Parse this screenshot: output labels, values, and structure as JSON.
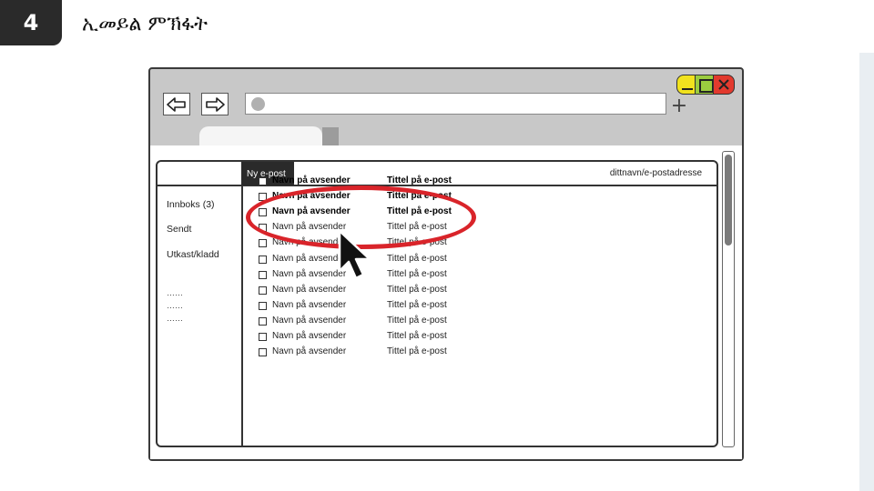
{
  "step": {
    "number": "4",
    "title": "ኢመይል ምኽፋት"
  },
  "browser": {
    "back_icon": "arrow-left-icon",
    "forward_icon": "arrow-right-icon",
    "new_tab_symbol": "+",
    "window_controls": [
      "minimize",
      "maximize",
      "close"
    ],
    "colors": {
      "minimize": "#f1e21e",
      "maximize": "#9bcc3f",
      "close": "#e23a2e"
    }
  },
  "mail": {
    "new_mail_label": "Ny e-post",
    "user_address": "dittnavn/e-postadresse",
    "folders": [
      "Innboks (3)",
      "Sendt",
      "Utkast/kladd"
    ],
    "placeholders": [
      "……",
      "……",
      "……"
    ],
    "rows": [
      {
        "sender": "Navn på avsender",
        "subject": "Tittel på e-post",
        "unread": true
      },
      {
        "sender": "Navn på avsender",
        "subject": "Tittel på e-post",
        "unread": true
      },
      {
        "sender": "Navn på avsender",
        "subject": "Tittel på e-post",
        "unread": true
      },
      {
        "sender": "Navn på avsender",
        "subject": "Tittel på e-post",
        "unread": false
      },
      {
        "sender": "Navn på avsender",
        "subject": "Tittel på e-post",
        "unread": false
      },
      {
        "sender": "Navn på avsender",
        "subject": "Tittel på e-post",
        "unread": false
      },
      {
        "sender": "Navn på avsender",
        "subject": "Tittel på e-post",
        "unread": false
      },
      {
        "sender": "Navn på avsender",
        "subject": "Tittel på e-post",
        "unread": false
      },
      {
        "sender": "Navn på avsender",
        "subject": "Tittel på e-post",
        "unread": false
      },
      {
        "sender": "Navn på avsender",
        "subject": "Tittel på e-post",
        "unread": false
      },
      {
        "sender": "Navn på avsender",
        "subject": "Tittel på e-post",
        "unread": false
      },
      {
        "sender": "Navn på avsender",
        "subject": "Tittel på e-post",
        "unread": false
      }
    ],
    "highlight_color": "#d9242a",
    "cursor_icon": "mouse-pointer-icon"
  }
}
